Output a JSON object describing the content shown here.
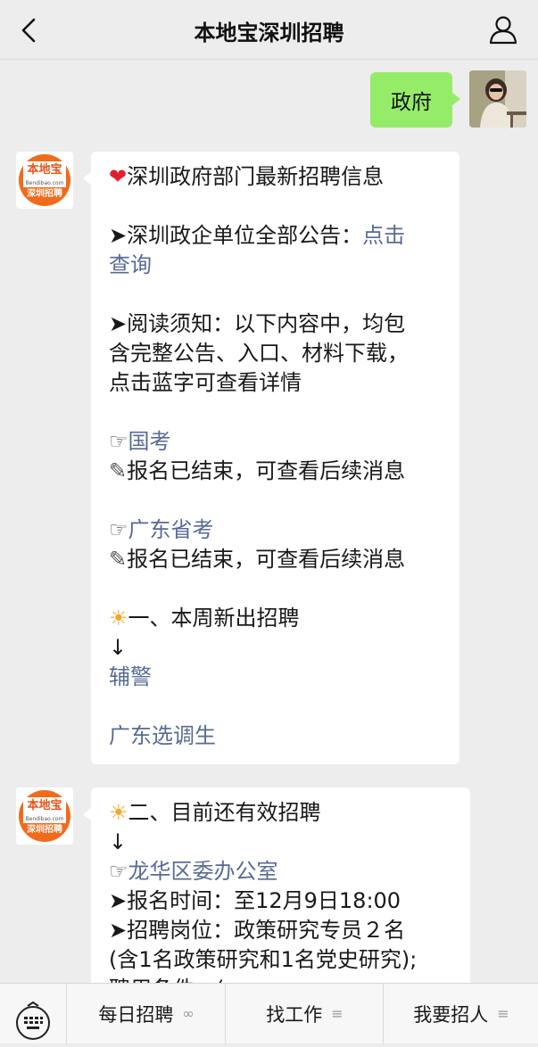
{
  "header": {
    "title": "本地宝深圳招聘",
    "back_icon": "back-icon",
    "profile_icon": "person-icon"
  },
  "my_message": {
    "text": "政府"
  },
  "bot_logo": {
    "brand": "本地宝",
    "site": "Bendibao.com",
    "sub": "深圳招聘"
  },
  "message1": {
    "heading": "深圳政府部门最新招聘信息",
    "notice_prefix": "➤深圳政企单位全部公告：",
    "notice_link_part1": "点击",
    "notice_link_part2": "查询",
    "reading_l1": "➤阅读须知：以下内容中，均包",
    "reading_l2": "含完整公告、入口、材料下载，",
    "reading_l3": "点击蓝字可查看详情",
    "hand": "☞",
    "pencil": "✎",
    "guokao_link": "国考",
    "guokao_status": "报名已结束，可查看后续消息",
    "shengkao_link": "广东省考",
    "shengkao_status": "报名已结束，可查看后续消息",
    "week_heading": "一、本周新出招聘",
    "arrow": "↓",
    "link_fujing": "辅警",
    "link_xuandiao": "广东选调生"
  },
  "message2": {
    "valid_heading": "二、目前还有效招聘",
    "arrow": "↓",
    "hand": "☞",
    "org_link": "龙华区委办公室",
    "reg_time": "➤报名时间：至12月9日18:00",
    "positions": "➤招聘岗位：政策研究专员２名",
    "positions_detail": "(含1名政策研究和1名党史研究);",
    "cut_line": "聘用条件：(..."
  },
  "footer": {
    "keyboard_icon": "keyboard-icon",
    "menu": [
      {
        "label": "每日招聘",
        "icon": "link-icon"
      },
      {
        "label": "找工作",
        "icon": "menu-icon"
      },
      {
        "label": "我要招人",
        "icon": "menu-icon"
      }
    ]
  },
  "colors": {
    "link": "#576b95",
    "self_bubble": "#95ec69",
    "background": "#ededed",
    "logo_orange": "#f26a1b"
  }
}
